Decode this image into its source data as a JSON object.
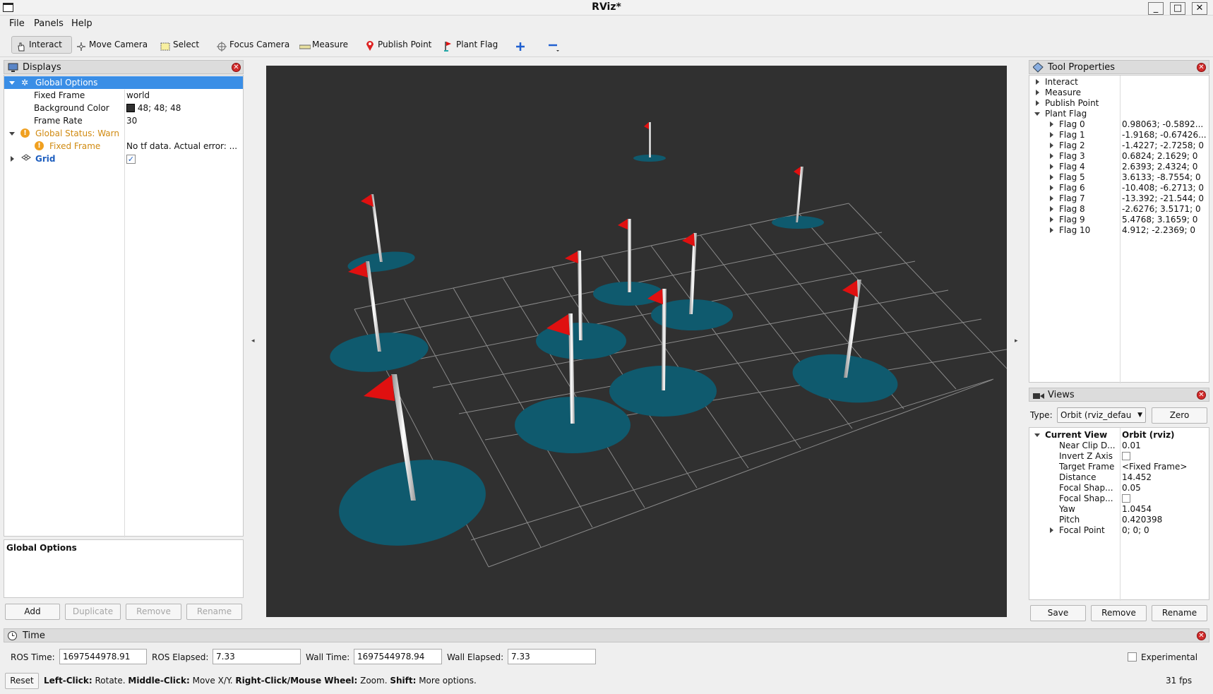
{
  "window": {
    "title": "RViz*"
  },
  "menu": {
    "file": "File",
    "panels": "Panels",
    "help": "Help"
  },
  "toolbar": {
    "interact": "Interact",
    "move_camera": "Move Camera",
    "select": "Select",
    "focus_camera": "Focus Camera",
    "measure": "Measure",
    "publish_point": "Publish Point",
    "plant_flag": "Plant Flag"
  },
  "displays": {
    "title": "Displays",
    "global_options": "Global Options",
    "fixed_frame_label": "Fixed Frame",
    "fixed_frame_value": "world",
    "bg_color_label": "Background Color",
    "bg_color_value": "48; 48; 48",
    "bg_color_swatch": "#303030",
    "frame_rate_label": "Frame Rate",
    "frame_rate_value": "30",
    "global_status": "Global Status: Warn",
    "status_fixed_frame": "Fixed Frame",
    "status_fixed_frame_value": "No tf data.  Actual error: ...",
    "grid_label": "Grid",
    "description_title": "Global Options",
    "add": "Add",
    "duplicate": "Duplicate",
    "remove": "Remove",
    "rename": "Rename"
  },
  "tool_properties": {
    "title": "Tool Properties",
    "items": [
      "Interact",
      "Measure",
      "Publish Point",
      "Plant Flag"
    ],
    "flags": [
      {
        "name": "Flag 0",
        "value": "0.98063; -0.5892..."
      },
      {
        "name": "Flag 1",
        "value": "-1.9168; -0.67426..."
      },
      {
        "name": "Flag 2",
        "value": "-1.4227; -2.7258; 0"
      },
      {
        "name": "Flag 3",
        "value": "0.6824; 2.1629; 0"
      },
      {
        "name": "Flag 4",
        "value": "2.6393; 2.4324; 0"
      },
      {
        "name": "Flag 5",
        "value": "3.6133; -8.7554; 0"
      },
      {
        "name": "Flag 6",
        "value": "-10.408; -6.2713; 0"
      },
      {
        "name": "Flag 7",
        "value": "-13.392; -21.544; 0"
      },
      {
        "name": "Flag 8",
        "value": "-2.6276; 3.5171; 0"
      },
      {
        "name": "Flag 9",
        "value": "5.4768; 3.1659; 0"
      },
      {
        "name": "Flag 10",
        "value": "4.912; -2.2369; 0"
      }
    ]
  },
  "views": {
    "title": "Views",
    "type_label": "Type:",
    "type_value": "Orbit (rviz_defau",
    "zero": "Zero",
    "current_view": "Current View",
    "current_view_value": "Orbit (rviz)",
    "props": [
      {
        "name": "Near Clip D...",
        "value": "0.01"
      },
      {
        "name": "Invert Z Axis",
        "value": ""
      },
      {
        "name": "Target Frame",
        "value": "<Fixed Frame>"
      },
      {
        "name": "Distance",
        "value": "14.452"
      },
      {
        "name": "Focal Shap...",
        "value": "0.05"
      },
      {
        "name": "Focal Shap...",
        "value": ""
      },
      {
        "name": "Yaw",
        "value": "1.0454"
      },
      {
        "name": "Pitch",
        "value": "0.420398"
      },
      {
        "name": "Focal Point",
        "value": "0; 0; 0"
      }
    ],
    "save": "Save",
    "remove": "Remove",
    "rename": "Rename"
  },
  "time": {
    "title": "Time",
    "ros_time_label": "ROS Time:",
    "ros_time": "1697544978.91",
    "ros_elapsed_label": "ROS Elapsed:",
    "ros_elapsed": "7.33",
    "wall_time_label": "Wall Time:",
    "wall_time": "1697544978.94",
    "wall_elapsed_label": "Wall Elapsed:",
    "wall_elapsed": "7.33",
    "experimental": "Experimental",
    "reset": "Reset",
    "help_b1": "Left-Click:",
    "help_t1": " Rotate. ",
    "help_b2": "Middle-Click:",
    "help_t2": " Move X/Y. ",
    "help_b3": "Right-Click/Mouse Wheel:",
    "help_t3": " Zoom. ",
    "help_b4": "Shift:",
    "help_t4": " More options.",
    "fps": "31 fps"
  },
  "colors": {
    "viewport_bg": "#303030",
    "disc": "#0f5a6e",
    "flag": "#e01010",
    "selection": "#3a8ee6"
  }
}
